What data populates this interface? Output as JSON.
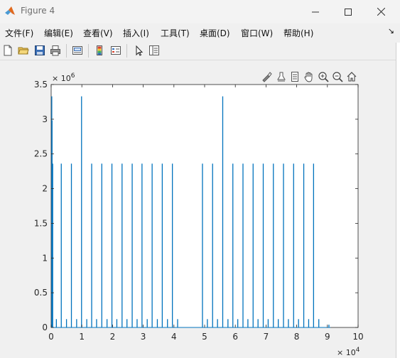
{
  "window": {
    "title": "Figure 4",
    "minimize_icon": "minimize-icon",
    "maximize_icon": "maximize-icon",
    "close_icon": "close-icon"
  },
  "menubar": {
    "items": [
      "文件(F)",
      "编辑(E)",
      "查看(V)",
      "插入(I)",
      "工具(T)",
      "桌面(D)",
      "窗口(W)",
      "帮助(H)"
    ],
    "dock_arrow": "↘"
  },
  "toolbar": {
    "icons": [
      "new-figure-icon",
      "open-file-icon",
      "save-icon",
      "print-icon",
      "link-plot-icon",
      "insert-colorbar-icon",
      "insert-legend-icon",
      "edit-plot-arrow-icon",
      "property-inspector-icon"
    ]
  },
  "axes_toolbar": {
    "icons": [
      "brush-icon",
      "data-tips-icon",
      "restore-view-icon",
      "pan-hand-icon",
      "zoom-in-icon",
      "zoom-out-icon",
      "home-icon"
    ]
  },
  "colors": {
    "series": "#0072BD",
    "axes": "#262626",
    "window_bg": "#f0f0f0"
  },
  "chart_data": {
    "type": "line",
    "xlim": [
      0,
      10
    ],
    "ylim": [
      0,
      3.5
    ],
    "xticks": [
      "0",
      "1",
      "2",
      "3",
      "4",
      "5",
      "6",
      "7",
      "8",
      "9",
      "10"
    ],
    "yticks": [
      "0",
      "0.5",
      "1",
      "1.5",
      "2",
      "2.5",
      "3",
      "3.5"
    ],
    "x_exponent_base": "× 10",
    "x_exponent_power": "4",
    "y_exponent_base": "× 10",
    "y_exponent_power": "6",
    "grid": false,
    "x_unit_scale": 10000,
    "y_unit_scale": 1000000,
    "spikes": [
      {
        "x": 0.02,
        "y": 3.33
      },
      {
        "x": 0.03,
        "y": 2.98
      },
      {
        "x": 0.05,
        "y": 2.36
      },
      {
        "x": 0.17,
        "y": 0.12
      },
      {
        "x": 0.33,
        "y": 2.36
      },
      {
        "x": 0.5,
        "y": 0.12
      },
      {
        "x": 0.66,
        "y": 2.36
      },
      {
        "x": 0.83,
        "y": 0.12
      },
      {
        "x": 0.99,
        "y": 3.33
      },
      {
        "x": 1.16,
        "y": 0.12
      },
      {
        "x": 1.32,
        "y": 2.36
      },
      {
        "x": 1.48,
        "y": 0.12
      },
      {
        "x": 1.65,
        "y": 2.36
      },
      {
        "x": 1.82,
        "y": 0.12
      },
      {
        "x": 1.98,
        "y": 2.36
      },
      {
        "x": 2.14,
        "y": 0.12
      },
      {
        "x": 2.31,
        "y": 2.36
      },
      {
        "x": 2.47,
        "y": 0.12
      },
      {
        "x": 2.64,
        "y": 2.36
      },
      {
        "x": 2.8,
        "y": 0.12
      },
      {
        "x": 2.96,
        "y": 2.36
      },
      {
        "x": 3.13,
        "y": 0.12
      },
      {
        "x": 3.29,
        "y": 2.36
      },
      {
        "x": 3.46,
        "y": 0.12
      },
      {
        "x": 3.62,
        "y": 2.36
      },
      {
        "x": 3.79,
        "y": 0.12
      },
      {
        "x": 3.95,
        "y": 2.36
      },
      {
        "x": 4.12,
        "y": 0.12
      },
      {
        "x": 4.93,
        "y": 2.36
      },
      {
        "x": 5.09,
        "y": 0.12
      },
      {
        "x": 5.26,
        "y": 2.36
      },
      {
        "x": 5.42,
        "y": 0.12
      },
      {
        "x": 5.59,
        "y": 3.33
      },
      {
        "x": 5.76,
        "y": 0.12
      },
      {
        "x": 5.92,
        "y": 2.36
      },
      {
        "x": 6.08,
        "y": 0.12
      },
      {
        "x": 6.25,
        "y": 2.36
      },
      {
        "x": 6.41,
        "y": 0.12
      },
      {
        "x": 6.58,
        "y": 2.36
      },
      {
        "x": 6.74,
        "y": 0.12
      },
      {
        "x": 6.91,
        "y": 2.36
      },
      {
        "x": 7.07,
        "y": 0.12
      },
      {
        "x": 7.24,
        "y": 2.36
      },
      {
        "x": 7.4,
        "y": 0.12
      },
      {
        "x": 7.57,
        "y": 2.36
      },
      {
        "x": 7.73,
        "y": 0.12
      },
      {
        "x": 7.9,
        "y": 2.36
      },
      {
        "x": 8.06,
        "y": 0.12
      },
      {
        "x": 8.23,
        "y": 2.36
      },
      {
        "x": 8.39,
        "y": 0.12
      },
      {
        "x": 8.55,
        "y": 2.36
      },
      {
        "x": 8.72,
        "y": 0.12
      },
      {
        "x": 9.05,
        "y": 0.04
      }
    ]
  }
}
